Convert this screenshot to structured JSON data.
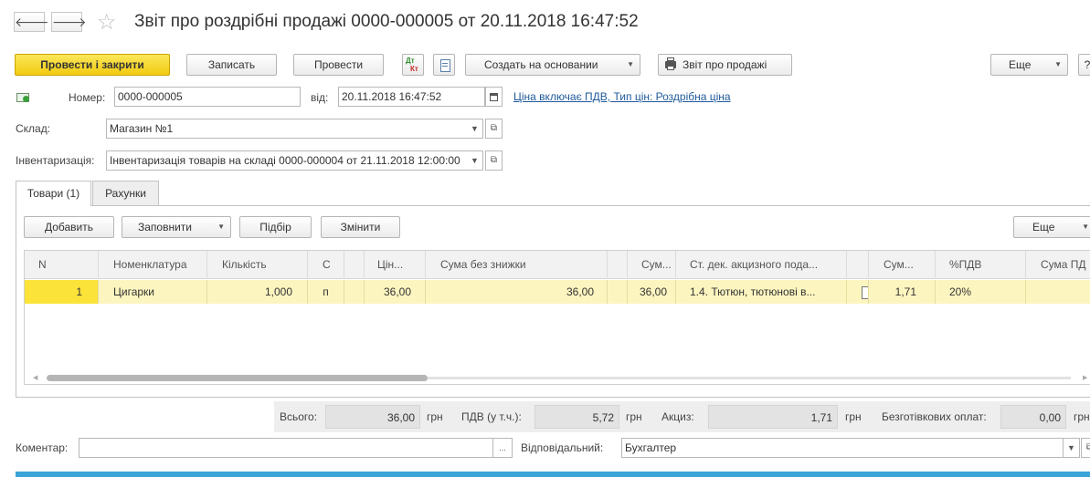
{
  "header": {
    "back_glyph": "🡐",
    "forward_glyph": "🡒",
    "star_glyph": "☆",
    "title": "Звіт про роздрібні продажі 0000-000005 от 20.11.2018 16:47:52"
  },
  "toolbar": {
    "post_close": "Провести і закрити",
    "save": "Записать",
    "post": "Провести",
    "dtkt_top": "Дт",
    "dtkt_bottom": "Кт",
    "create_based": "Создать на основании",
    "sales_report": "Звіт про продажі",
    "more": "Еще",
    "help": "?"
  },
  "form": {
    "number_label": "Номер:",
    "number_value": "0000-000005",
    "date_label": "від:",
    "date_value": "20.11.2018 16:47:52",
    "price_link": "Ціна включає ПДВ, Тип цін: Роздрібна ціна",
    "warehouse_label": "Склад:",
    "warehouse_value": "Магазин №1",
    "inventory_label": "Інвентаризація:",
    "inventory_value": "Інвентаризація товарів на складі 0000-000004 от 21.11.2018 12:00:00"
  },
  "tabs": [
    {
      "label": "Товари (1)"
    },
    {
      "label": "Рахунки"
    }
  ],
  "table_toolbar": {
    "add": "Добавить",
    "fill": "Заповнити",
    "select": "Підбір",
    "change": "Змінити",
    "more": "Еще"
  },
  "table": {
    "columns": [
      "N",
      "Номенклатура",
      "Кількість",
      "С",
      "",
      "Цін...",
      "Сума без знижки",
      "",
      "Сум...",
      "Ст. дек. акцизного пода...",
      "",
      "Сум...",
      "%ПДВ",
      "Сума ПД"
    ],
    "rows": [
      {
        "n": "1",
        "item": "Цигарки",
        "qty": "1,000",
        "unit": "п",
        "price": "36,00",
        "sum_no_discount": "36,00",
        "sum": "36,00",
        "excise_line": "1.4. Тютюн, тютюнові в...",
        "excise_sum": "1,71",
        "vat_rate": "20%",
        "vat_sum": ""
      }
    ]
  },
  "totals": {
    "total_label": "Всього:",
    "total_value": "36,00",
    "total_currency": "грн",
    "vat_label": "ПДВ (у т.ч.):",
    "vat_value": "5,72",
    "vat_currency": "грн",
    "excise_label": "Акциз:",
    "excise_value": "1,71",
    "excise_currency": "грн",
    "noncash_label": "Безготівкових оплат:",
    "noncash_value": "0,00",
    "noncash_currency": "грн"
  },
  "footer": {
    "comment_label": "Коментар:",
    "comment_value": "",
    "comment_btn": "...",
    "responsible_label": "Відповідальний:",
    "responsible_value": "Бухгалтер"
  },
  "colors": {
    "primary_button": "#f2cb10",
    "selected_row": "#fdf5c0",
    "current_cell": "#fbe33a",
    "link": "#1f5a9a",
    "bottom_bar": "#3aa3d8"
  }
}
